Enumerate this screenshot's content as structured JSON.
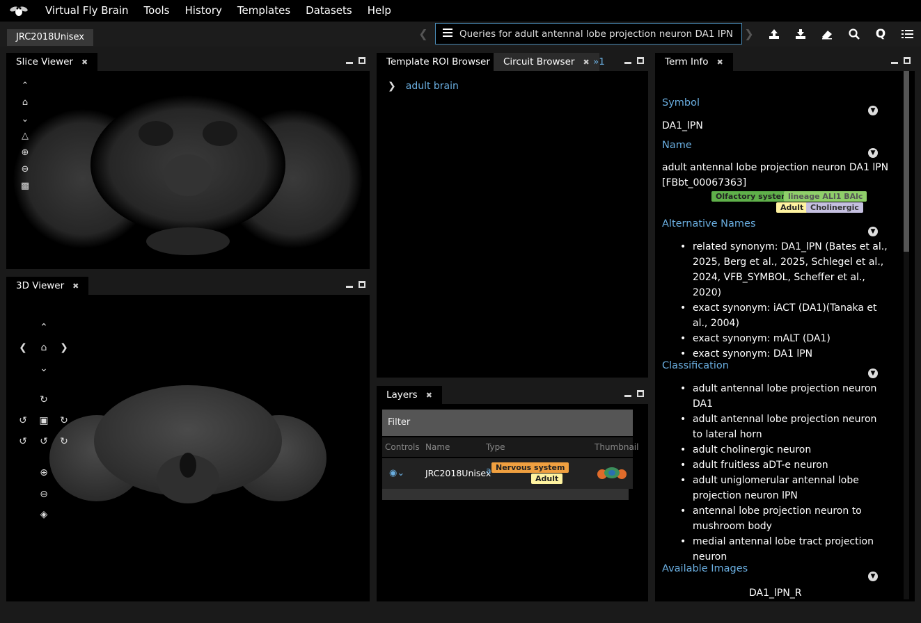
{
  "menubar": {
    "items": [
      "Virtual Fly Brain",
      "Tools",
      "History",
      "Templates",
      "Datasets",
      "Help"
    ]
  },
  "toolbar": {
    "template_tab": "JRC2018Unisex",
    "query_text": "Queries for adult antennal lobe projection neuron DA1 IPN",
    "icons": [
      "upload-icon",
      "download-icon",
      "eraser-icon",
      "search-icon",
      "query-icon",
      "list-icon"
    ]
  },
  "slice_viewer": {
    "title": "Slice Viewer"
  },
  "viewer_3d": {
    "title": "3D Viewer"
  },
  "roi_browser": {
    "tabs": [
      "Template ROI Browser",
      "Circuit Browser",
      "»1"
    ],
    "tree_item": "adult brain"
  },
  "layers": {
    "title": "Layers",
    "filter_placeholder": "Filter",
    "columns": [
      "Controls",
      "Name",
      "Type",
      "Thumbnail"
    ],
    "row": {
      "name": "JRC2018Unisex",
      "type_prefix": "a",
      "badges": [
        "Nervous system",
        "Adult"
      ]
    }
  },
  "term_info": {
    "title": "Term Info",
    "symbol_label": "Symbol",
    "symbol_value": "DA1_lPN",
    "name_label": "Name",
    "name_value": "adult antennal lobe projection neuron DA1 lPN",
    "name_id": "[FBbt_00067363]",
    "tags": [
      "Olfactory system",
      "lineage ALl1 BAlc",
      "Adult",
      "Cholinergic"
    ],
    "alt_names_label": "Alternative Names",
    "alt_names": [
      "related synonym: DA1_lPN (Bates et al., 2025, Berg et al., 2025, Schlegel et al., 2024, VFB_SYMBOL, Scheffer et al., 2020)",
      "exact synonym: iACT (DA1)(Tanaka et al., 2004)",
      "exact synonym: mALT (DA1)",
      "exact synonym: DA1 lPN"
    ],
    "classification_label": "Classification",
    "classification": [
      "adult antennal lobe projection neuron DA1",
      "adult antennal lobe projection neuron to lateral horn",
      "adult cholinergic neuron",
      "adult fruitless aDT-e neuron",
      "adult uniglomerular antennal lobe projection neuron lPN",
      "antennal lobe projection neuron to mushroom body",
      "medial antennal lobe tract projection neuron"
    ],
    "images_label": "Available Images",
    "image_name": "DA1_lPN_R"
  },
  "colors": {
    "accent": "#6aaee0",
    "badge_orange": "#f0a040",
    "badge_yellow": "#fff3a0",
    "badge_green": "#5fb04a",
    "badge_lightgreen": "#8fcf6a",
    "badge_lavender": "#c5c0e0"
  }
}
